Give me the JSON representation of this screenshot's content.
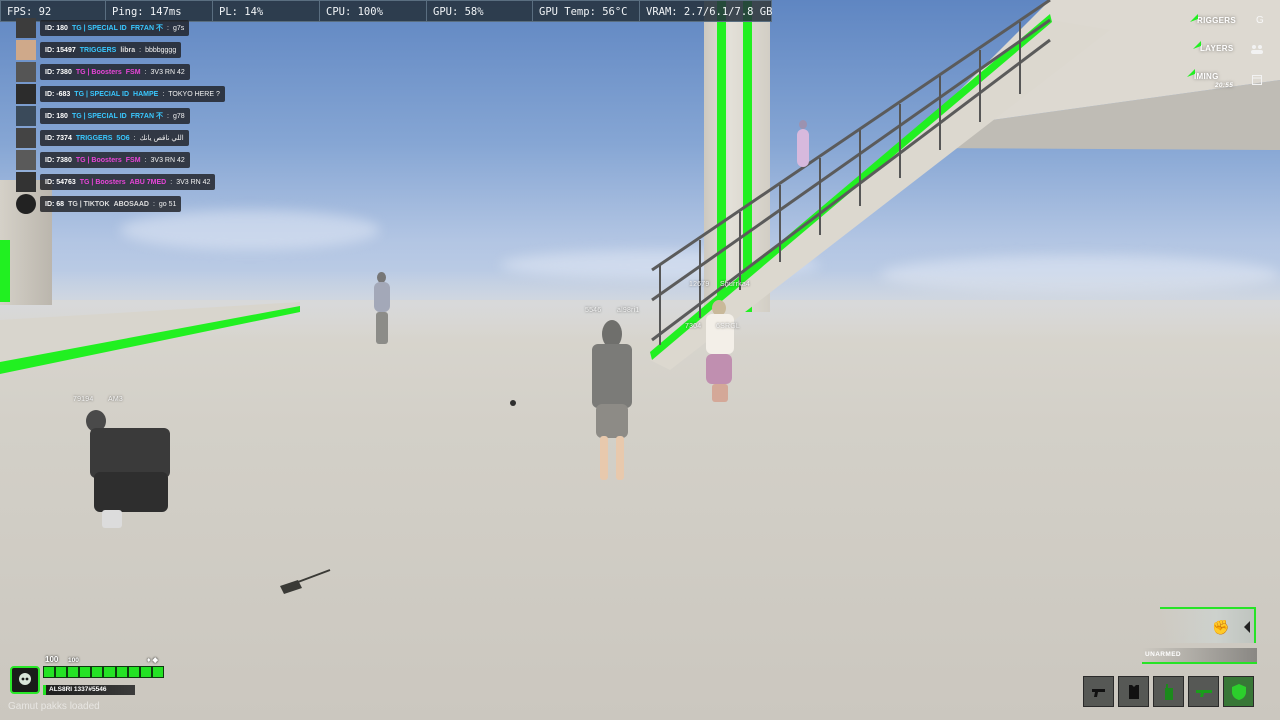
{
  "perf": {
    "fps": "FPS: 92",
    "ping": "Ping: 147ms",
    "pl": "PL: 14%",
    "cpu": "CPU: 100%",
    "gpu": "GPU: 58%",
    "gpu_temp": "GPU Temp: 56°C",
    "vram": "VRAM: 2.7/6.1/7.8 GB"
  },
  "chat": [
    {
      "id": "ID: 180",
      "group": "TG | SPECIAL ID",
      "group_color": "cyan",
      "name": "FR7AN 不",
      "name_color": "cyan",
      "msg": "g7s",
      "avatar": "avatar-icon"
    },
    {
      "id": "ID: 15497",
      "group": "TRIGGERS",
      "group_color": "cyan",
      "name": "libra",
      "name_color": "gray",
      "msg": "bbbbgggg",
      "avatar": "avatar-icon"
    },
    {
      "id": "ID: 7380",
      "group": "TG | Boosters",
      "group_color": "pink",
      "name": "FSM",
      "name_color": "pink",
      "msg": "3V3 RN 42",
      "avatar": "avatar-icon"
    },
    {
      "id": "ID: -683",
      "group": "TG | SPECIAL ID",
      "group_color": "cyan",
      "name": "HAMPE",
      "name_color": "cyan",
      "msg": "TOKYO HERE ?",
      "avatar": "avatar-icon"
    },
    {
      "id": "ID: 180",
      "group": "TG | SPECIAL ID",
      "group_color": "cyan",
      "name": "FR7AN 不",
      "name_color": "cyan",
      "msg": "g78",
      "avatar": "avatar-icon"
    },
    {
      "id": "ID: 7374",
      "group": "TRIGGERS",
      "group_color": "cyan",
      "name": "5O6",
      "name_color": "cyan",
      "msg": "اللي ناقص يانك",
      "avatar": "avatar-icon"
    },
    {
      "id": "ID: 7380",
      "group": "TG | Boosters",
      "group_color": "pink",
      "name": "FSM",
      "name_color": "pink",
      "msg": "3V3 RN 42",
      "avatar": "avatar-icon"
    },
    {
      "id": "ID: 54763",
      "group": "TG | Boosters",
      "group_color": "pink",
      "name": "ABU 7MED",
      "name_color": "pink",
      "msg": "3V3 RN 42",
      "avatar": "avatar-icon"
    },
    {
      "id": "ID: 68",
      "group": "TG | TIKTOK",
      "group_color": "gray",
      "name": "ABOSAAD",
      "name_color": "gray",
      "msg": "go 51",
      "avatar": "avatar-icon"
    }
  ],
  "top_right": {
    "triggers": "RIGGERS",
    "players": "LAYERS",
    "timing": "IMING",
    "time": "20:55",
    "icon_g": "G",
    "icon_people": "people-icon",
    "icon_calendar": "calendar-icon"
  },
  "nametags": {
    "center_id": "5546",
    "center_name": "al98ri1",
    "left_id": "79194",
    "left_name": "AM3",
    "stair_id": "12679",
    "stair_name": "Shurrka4",
    "girl_id": "7304",
    "girl_name": "6SRGL"
  },
  "status": {
    "health": "100",
    "armor": "100",
    "player_tag": "ALS8RI 1337#5546",
    "health_fraction": 1.0,
    "loading_text": "Gamut pakks loaded"
  },
  "weapon": {
    "label": "UNARMED",
    "fist_icon": "fist-icon"
  },
  "hotbar": [
    {
      "name": "pistol-icon"
    },
    {
      "name": "armor-vest-icon"
    },
    {
      "name": "radio-icon"
    },
    {
      "name": "rifle-icon"
    },
    {
      "name": "shield-icon"
    }
  ],
  "colors": {
    "accent_green": "#21f021",
    "pink_tag": "#e845d8",
    "cyan_tag": "#39c8ff"
  }
}
